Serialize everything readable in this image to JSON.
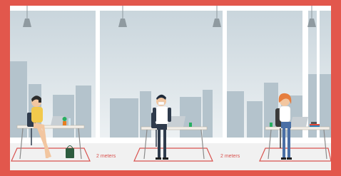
{
  "scene": {
    "labels": [
      {
        "id": "left-gap",
        "text": "2 meters"
      },
      {
        "id": "right-gap",
        "text": "2 meters"
      }
    ],
    "colors": {
      "border": "#e2574c",
      "window_bg": "#dfe7ec",
      "sky_top": "#c9d5dc",
      "buildings": "#b4c3cc",
      "floor": "#f1f1f1",
      "zone_line": "#d9534f",
      "desk_top": "#f3efe9",
      "desk_leg": "#8a8a8a",
      "lamp": "#8f9aa0"
    },
    "people": [
      {
        "name": "woman-on-phone",
        "shirt": "#f2c94c",
        "hair": "#2b2b2b"
      },
      {
        "name": "man-with-mask",
        "shirt": "#ffffff",
        "hair": "#1f2a3a"
      },
      {
        "name": "woman-red-hair",
        "shirt": "#ffffff",
        "hair": "#e67e3f"
      }
    ]
  }
}
